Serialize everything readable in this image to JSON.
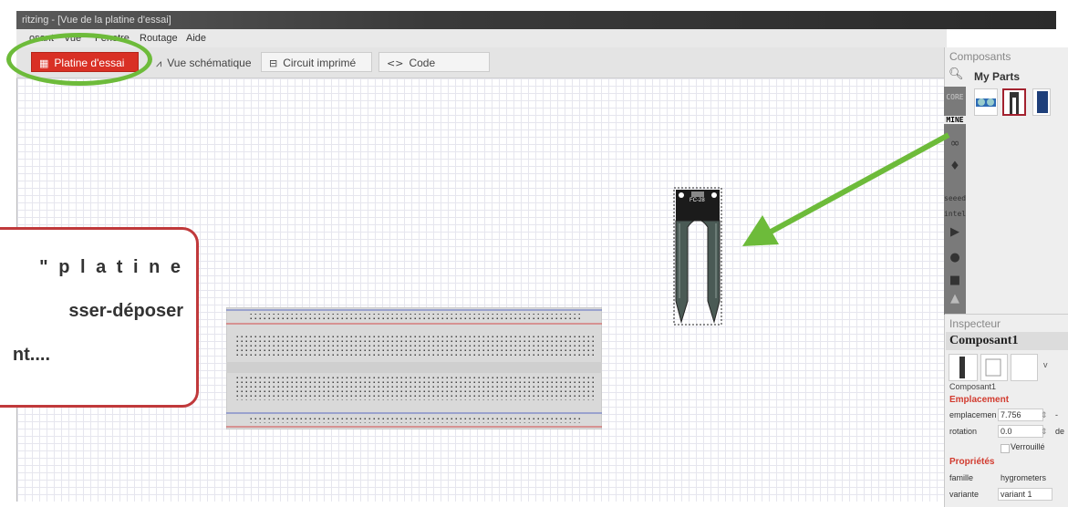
{
  "window": {
    "title": "ritzing - [Vue de la platine d'essai]"
  },
  "menu": [
    "osant",
    "Vue",
    "Fenetre",
    "Routage",
    "Aide"
  ],
  "tabs": [
    {
      "label": "Platine d'essai",
      "icon": "breadboard-icon",
      "active": true
    },
    {
      "label": "Vue schématique",
      "icon": "schematic-icon",
      "active": false
    },
    {
      "label": "Circuit imprimé",
      "icon": "pcb-icon",
      "active": false
    },
    {
      "label": "Code",
      "icon": "code-icon",
      "active": false
    }
  ],
  "parts_panel": {
    "title": "Composants",
    "bin_title": "My Parts",
    "strip_labels": {
      "core": "CORE",
      "mine": "MINE",
      "seeed": "seeed",
      "intel": "intel"
    }
  },
  "canvas": {
    "sensor_label": "FC-28"
  },
  "inspector": {
    "title": "Inspecteur",
    "component_name": "Composant1",
    "component_caption": "Composant1",
    "section_location": "Emplacement",
    "location_label": "emplacemen",
    "location_value": "7.756",
    "rotation_label": "rotation",
    "rotation_value": "0.0",
    "rotation_unit": "de",
    "locked_label": "Verrouillé",
    "section_props": "Propriétés",
    "family_label": "famille",
    "family_value": "hygrometers",
    "variant_label": "variante",
    "variant_value": "variant 1"
  },
  "callout": {
    "line1": "\" p l a t i n e",
    "line2": "sser-déposer",
    "line3": "nt...."
  },
  "colors": {
    "accent": "#d93025",
    "highlight": "#6dbb3a",
    "callout_border": "#c0393b"
  }
}
